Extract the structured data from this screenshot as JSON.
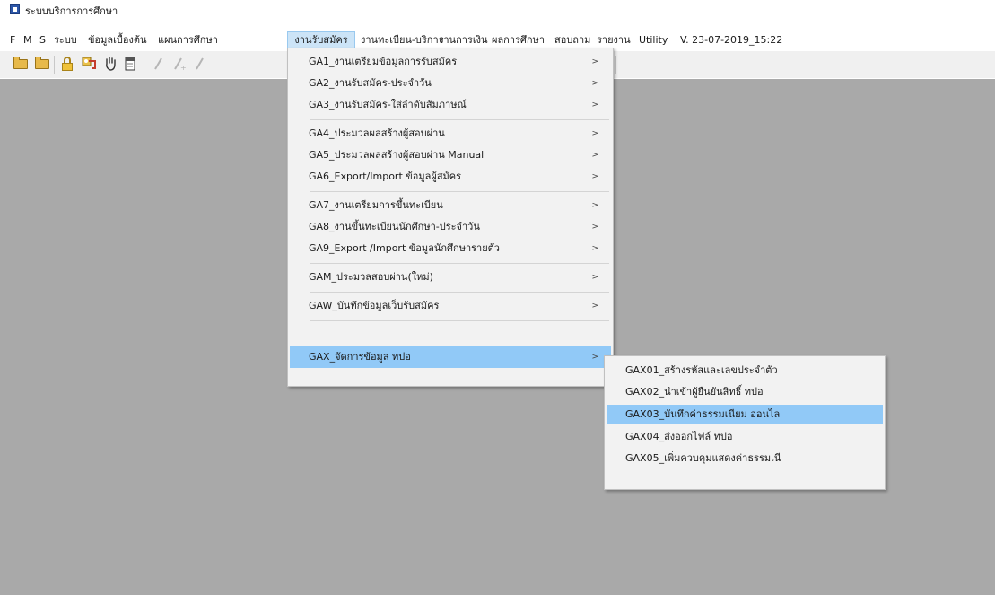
{
  "window": {
    "title": "ระบบบริการการศึกษา"
  },
  "menubar": {
    "items": [
      {
        "label": "F"
      },
      {
        "label": "M"
      },
      {
        "label": "S"
      },
      {
        "label": "ระบบ"
      },
      {
        "label": "ข้อมูลเบื้องต้น"
      },
      {
        "label": "แผนการศึกษา"
      },
      {
        "label": "งานรับสมัคร"
      },
      {
        "label": "งานทะเบียน-บริการ"
      },
      {
        "label": "งานการเงิน"
      },
      {
        "label": "ผลการศึกษา"
      },
      {
        "label": "สอบถาม"
      },
      {
        "label": "รายงาน"
      },
      {
        "label": "Utility"
      },
      {
        "label": "V. 23-07-2019_15:22"
      }
    ],
    "active_index": 6
  },
  "toolbar": {
    "icons": [
      "open-folder-icon",
      "folder-icon",
      "lock-icon",
      "keys-icon",
      "hand-icon",
      "document-icon",
      "pencil-icon",
      "pencil-plus-icon",
      "pencil-icon"
    ]
  },
  "main_menu": {
    "items": [
      {
        "label": "GA1_งานเตรียมข้อมูลการรับสมัคร"
      },
      {
        "label": "GA2_งานรับสมัคร-ประจำวัน"
      },
      {
        "label": "GA3_งานรับสมัคร-ใส่ลำดับสัมภาษณ์"
      },
      {
        "label": "GA4_ประมวลผลสร้างผู้สอบผ่าน"
      },
      {
        "label": "GA5_ประมวลผลสร้างผู้สอบผ่าน Manual"
      },
      {
        "label": "GA6_Export/Import ข้อมูลผู้สมัคร"
      },
      {
        "label": "GA7_งานเตรียมการขึ้นทะเบียน"
      },
      {
        "label": "GA8_งานขึ้นทะเบียนนักศึกษา-ประจำวัน"
      },
      {
        "label": "GA9_Export /Import ข้อมูลนักศึกษารายตัว"
      },
      {
        "label": "GAM_ประมวลสอบผ่าน(ใหม่)"
      },
      {
        "label": "GAW_บันทึกข้อมูลเว็บรับสมัคร"
      },
      {
        "label": "GAX_จัดการข้อมูล ทปอ"
      }
    ],
    "highlighted_index": 11
  },
  "sub_menu": {
    "items": [
      {
        "label": "GAX01_สร้างรหัสและเลขประจำตัว"
      },
      {
        "label": "GAX02_นำเข้าผู้ยืนยันสิทธิ์ ทปอ"
      },
      {
        "label": "GAX03_บันทึกค่าธรรมเนียม ออนไล"
      },
      {
        "label": "GAX04_ส่งออกไฟล์ ทปอ"
      },
      {
        "label": "GAX05_เพิ่มควบคุมแสดงค่าธรรมเนี"
      }
    ],
    "highlighted_index": 2
  },
  "colors": {
    "client_bg": "#a9a9a9",
    "menu_highlight": "#91c9f7",
    "menubar_active": "#cce4f7"
  }
}
